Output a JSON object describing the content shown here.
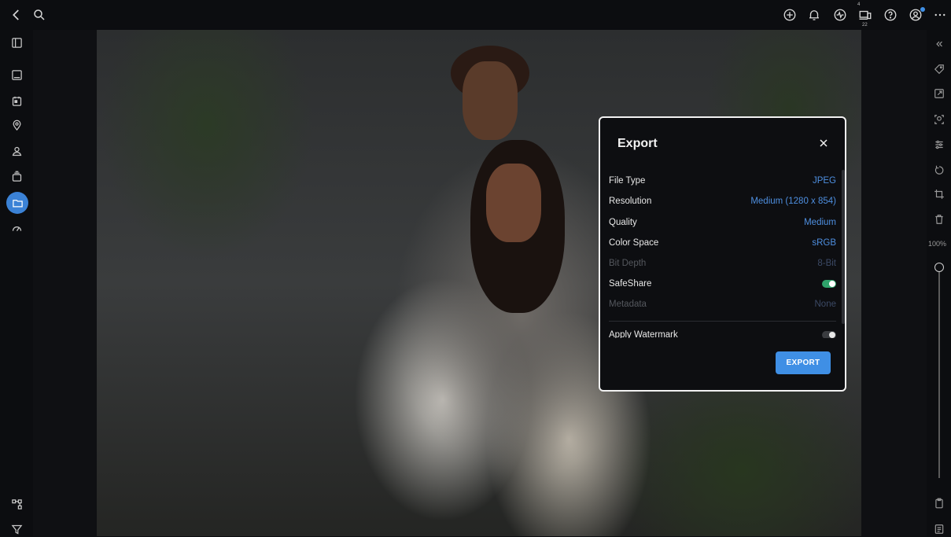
{
  "topbar": {
    "back_icon": "chevron-left-icon",
    "search_icon": "search-icon",
    "actions": [
      "add-circle-icon",
      "bell-icon",
      "activity-icon",
      "devices-icon",
      "help-icon",
      "account-icon",
      "more-icon"
    ],
    "devices_badge_top": "4",
    "devices_badge_bottom": "22"
  },
  "left_rail": {
    "items": [
      "panel-toggle-icon",
      "image-icon",
      "calendar-icon",
      "location-icon",
      "person-icon",
      "album-icon",
      "folder-icon",
      "speed-icon"
    ],
    "active": "folder-icon",
    "bottom": [
      "sitemap-icon",
      "filter-icon"
    ]
  },
  "right_rail": {
    "items": [
      "collapse-icon",
      "tag-icon",
      "share-icon",
      "face-icon",
      "adjust-icon",
      "rotate-icon",
      "crop-icon",
      "delete-icon"
    ],
    "zoom_label": "100%",
    "bottom": [
      "clipboard-icon",
      "info-icon"
    ]
  },
  "dialog": {
    "title": "Export",
    "rows": [
      {
        "label": "File Type",
        "value": "JPEG",
        "disabled": false
      },
      {
        "label": "Resolution",
        "value": "Medium (1280 x 854)",
        "disabled": false
      },
      {
        "label": "Quality",
        "value": "Medium",
        "disabled": false
      },
      {
        "label": "Color Space",
        "value": "sRGB",
        "disabled": false
      },
      {
        "label": "Bit Depth",
        "value": "8-Bit",
        "disabled": true
      },
      {
        "label": "SafeShare",
        "value": "",
        "toggle": true,
        "disabled": false
      },
      {
        "label": "Metadata",
        "value": "None",
        "disabled": true
      }
    ],
    "partial_row_label": "Apply Watermark",
    "export_button": "EXPORT"
  },
  "colors": {
    "accent": "#3f8fe5",
    "toggle_on": "#2fa36b",
    "link": "#4e8fe0"
  }
}
